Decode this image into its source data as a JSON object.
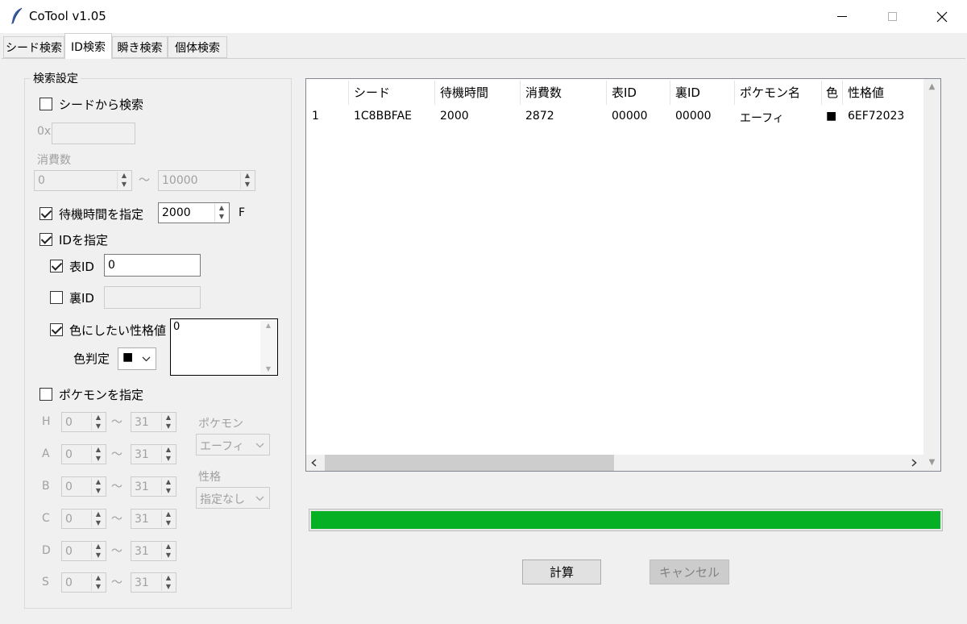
{
  "window": {
    "title": "CoTool v1.05",
    "icon": "feather-icon"
  },
  "tabs": [
    "シード検索",
    "ID検索",
    "瞬き検索",
    "個体検索"
  ],
  "active_tab": "ID検索",
  "settings": {
    "group_title": "検索設定",
    "seed_search": {
      "label": "シードから検索",
      "checked": false,
      "prefix": "0x",
      "value": ""
    },
    "consumption": {
      "label": "消費数",
      "min": "0",
      "sep": "〜",
      "max": "10000"
    },
    "wait_time": {
      "label": "待機時間を指定",
      "checked": true,
      "value": "2000",
      "unit": "F"
    },
    "id_spec": {
      "label": "IDを指定",
      "checked": true
    },
    "front_id": {
      "label": "表ID",
      "checked": true,
      "value": "0"
    },
    "back_id": {
      "label": "裏ID",
      "checked": false,
      "value": ""
    },
    "shiny_pid": {
      "label": "色にしたい性格値",
      "checked": true,
      "value": "0"
    },
    "color_judge": {
      "label": "色判定",
      "value": "■"
    },
    "pokemon_spec": {
      "label": "ポケモンを指定",
      "checked": false
    },
    "ivs": [
      {
        "stat": "H",
        "min": "0",
        "max": "31"
      },
      {
        "stat": "A",
        "min": "0",
        "max": "31"
      },
      {
        "stat": "B",
        "min": "0",
        "max": "31"
      },
      {
        "stat": "C",
        "min": "0",
        "max": "31"
      },
      {
        "stat": "D",
        "min": "0",
        "max": "31"
      },
      {
        "stat": "S",
        "min": "0",
        "max": "31"
      }
    ],
    "iv_sep": "〜",
    "pokemon": {
      "label": "ポケモン",
      "value": "エーフィ"
    },
    "nature": {
      "label": "性格",
      "value": "指定なし"
    }
  },
  "results": {
    "columns": [
      "シード",
      "待機時間",
      "消費数",
      "表ID",
      "裏ID",
      "ポケモン名",
      "色",
      "性格値"
    ],
    "rows": [
      {
        "index": "1",
        "seed": "1C8BBFAE",
        "wait": "2000",
        "consumption": "2872",
        "front_id": "00000",
        "back_id": "00000",
        "pokemon": "エーフィ",
        "color": "■",
        "pid": "6EF72023"
      }
    ]
  },
  "progress": {
    "value": 1.0,
    "color": "#06b025"
  },
  "buttons": {
    "calc": "計算",
    "cancel": "キャンセル"
  }
}
